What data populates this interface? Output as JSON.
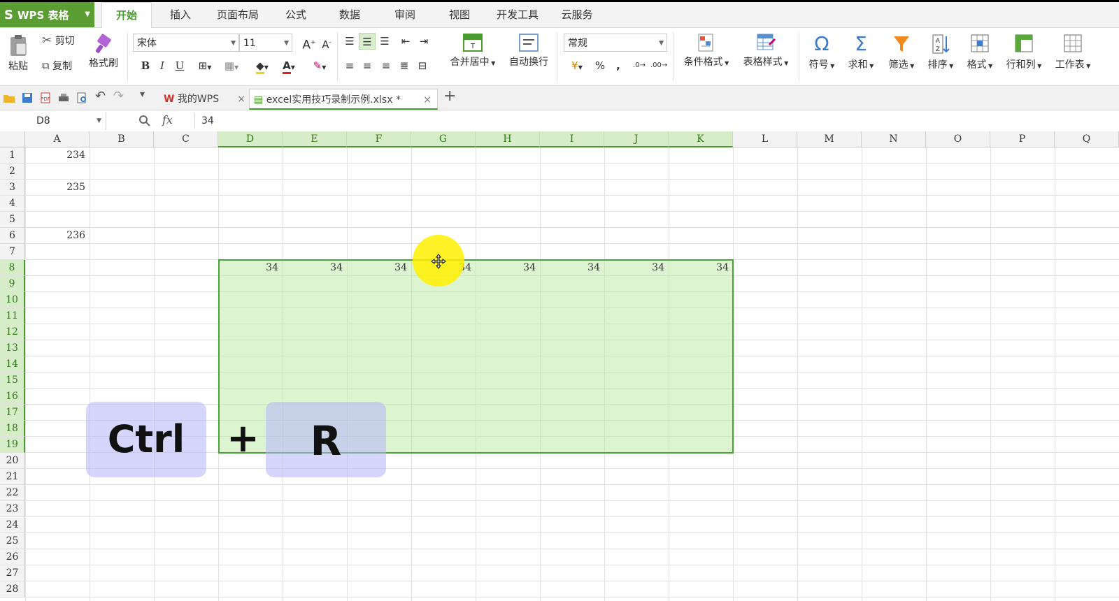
{
  "app": {
    "name": "WPS 表格",
    "logo": "S"
  },
  "menu_tabs": [
    "开始",
    "插入",
    "页面布局",
    "公式",
    "数据",
    "审阅",
    "视图",
    "开发工具",
    "云服务"
  ],
  "ribbon": {
    "paste": "粘贴",
    "cut": "剪切",
    "copy": "复制",
    "format_painter": "格式刷",
    "font_name": "宋体",
    "font_size": "11",
    "merge_center": "合并居中",
    "wrap_text": "自动换行",
    "number_format": "常规",
    "percent": "%",
    "comma": ",",
    "cond_format": "条件格式",
    "table_style": "表格样式",
    "symbol": "符号",
    "sum": "求和",
    "filter": "筛选",
    "sort": "排序",
    "format": "格式",
    "row_col": "行和列",
    "worksheet": "工作表",
    "bold": "B",
    "italic": "I",
    "underline": "U",
    "font_color_letter": "A"
  },
  "doc_tabs": [
    {
      "label": "我的WPS"
    },
    {
      "label": "excel实用技巧录制示例.xlsx *"
    }
  ],
  "formula_bar": {
    "name_box": "D8",
    "fx": "fx",
    "value": "34"
  },
  "columns": [
    "A",
    "B",
    "C",
    "D",
    "E",
    "F",
    "G",
    "H",
    "I",
    "J",
    "K",
    "L",
    "M",
    "N",
    "O",
    "P",
    "Q"
  ],
  "rows": [
    "1",
    "2",
    "3",
    "4",
    "5",
    "6",
    "7",
    "8",
    "9",
    "10",
    "11",
    "12",
    "13",
    "14",
    "15",
    "16",
    "17",
    "18",
    "19",
    "20",
    "21",
    "22",
    "23",
    "24",
    "25",
    "26",
    "27",
    "28"
  ],
  "cells": {
    "A1": "234",
    "A3": "235",
    "A6": "236",
    "D8": "34",
    "E8": "34",
    "F8": "34",
    "G8": "34",
    "H8": "34",
    "I8": "34",
    "J8": "34",
    "K8": "34"
  },
  "selection": "D8:K19",
  "shortcut": {
    "key1": "Ctrl",
    "plus": "+",
    "key2": "R"
  },
  "colors": {
    "accent": "#4b9a2d",
    "selection_fill": "#d7f0c8",
    "cursor_highlight": "#fff000"
  }
}
